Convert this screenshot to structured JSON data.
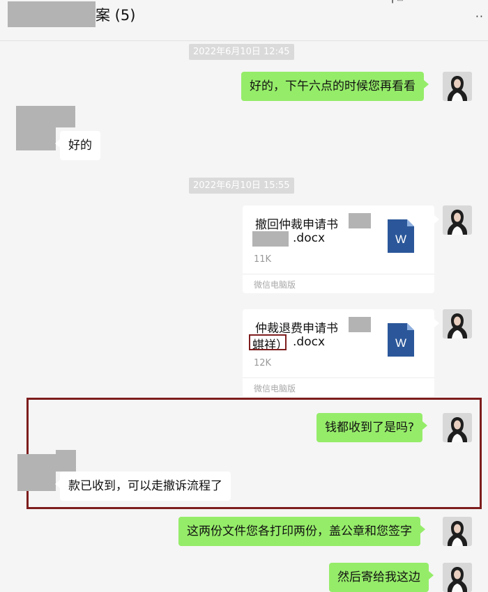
{
  "header": {
    "title": "案 (5)",
    "more_glyph": "··",
    "top_glyph": "┃          ▭"
  },
  "messages": {
    "ts1": "2022年6月10日 12:45",
    "m1": "好的，下午六点的时候您再看看",
    "m2": "好的",
    "ts2": "2022年6月10日 15:55",
    "file1": {
      "name_line1": "撤回仲裁申请书",
      "name_ext": ".docx",
      "size": "11K",
      "source": "微信电脑版",
      "icon": "W"
    },
    "file2": {
      "name_line1": "仲裁退费申请书",
      "name_part2": "蜞祥）",
      "name_ext": ".docx",
      "size": "12K",
      "source": "微信电脑版",
      "icon": "W"
    },
    "m3": "钱都收到了是吗?",
    "m4": "款已收到，可以走撤诉流程了",
    "m5": "这两份文件您各打印两份，盖公章和您签字",
    "m6": "然后寄给我这边"
  },
  "colors": {
    "background": "#f5f5f5",
    "outgoing_bubble": "#95ec69",
    "incoming_bubble": "#ffffff",
    "timestamp_bg": "#dadada",
    "highlight_box": "#7e1d1d",
    "word_blue": "#2b579a"
  },
  "icons": [
    "avatar-icon",
    "word-file-icon",
    "more-icon"
  ]
}
